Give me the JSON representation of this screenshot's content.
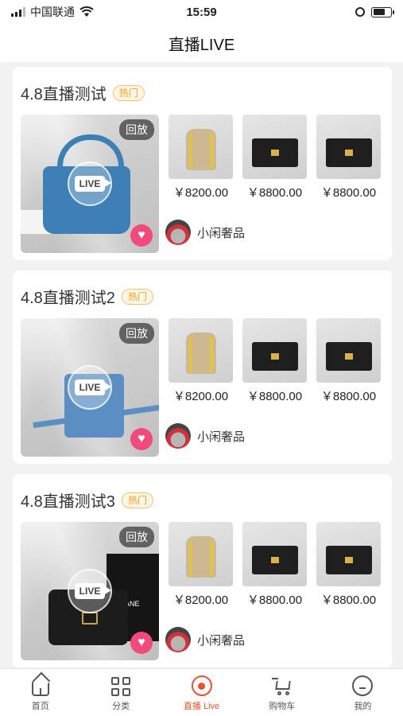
{
  "status_bar": {
    "carrier": "中国联通",
    "time": "15:59"
  },
  "nav": {
    "title": "直播LIVE"
  },
  "cards": [
    {
      "title": "4.8直播测试",
      "badge": "热门",
      "replay_label": "回放",
      "live_label": "LIVE",
      "cover": "blue-tote",
      "products": [
        {
          "price": "￥8200.00",
          "thumb": "backpack"
        },
        {
          "price": "￥8800.00",
          "thumb": "black-bag"
        },
        {
          "price": "￥8800.00",
          "thumb": "black-bag"
        }
      ],
      "shop_name": "小闲奢品"
    },
    {
      "title": "4.8直播测试2",
      "badge": "热门",
      "replay_label": "回放",
      "live_label": "LIVE",
      "cover": "blue-phone-bag",
      "products": [
        {
          "price": "￥8200.00",
          "thumb": "backpack"
        },
        {
          "price": "￥8800.00",
          "thumb": "black-bag"
        },
        {
          "price": "￥8800.00",
          "thumb": "black-bag"
        }
      ],
      "shop_name": "小闲奢品"
    },
    {
      "title": "4.8直播测试3",
      "badge": "热门",
      "replay_label": "回放",
      "live_label": "LIVE",
      "cover": "black-chanel-bag",
      "cover_text": "CHANE",
      "products": [
        {
          "price": "￥8200.00",
          "thumb": "backpack"
        },
        {
          "price": "￥8800.00",
          "thumb": "black-bag"
        },
        {
          "price": "￥8800.00",
          "thumb": "black-bag"
        }
      ],
      "shop_name": "小闲奢品"
    }
  ],
  "tabs": [
    {
      "label": "首页",
      "icon": "home-icon",
      "active": false
    },
    {
      "label": "分类",
      "icon": "category-icon",
      "active": false
    },
    {
      "label": "直播 Live",
      "icon": "live-icon",
      "active": true
    },
    {
      "label": "购物车",
      "icon": "cart-icon",
      "active": false
    },
    {
      "label": "我的",
      "icon": "profile-icon",
      "active": false
    }
  ],
  "colors": {
    "accent": "#e8532a",
    "hot_badge": "#f0a020",
    "heart": "#f24a7a"
  }
}
